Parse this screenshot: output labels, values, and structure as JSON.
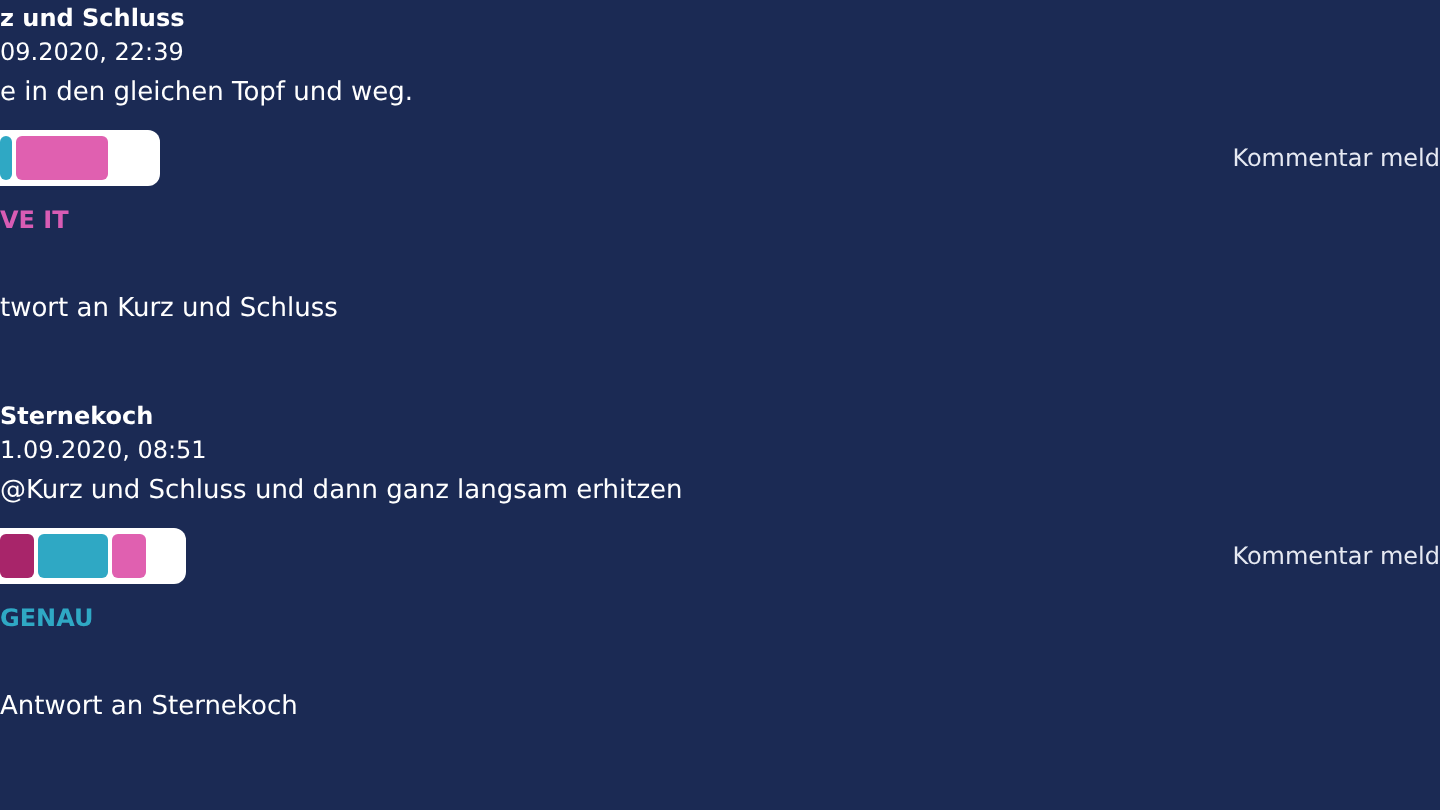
{
  "comments": [
    {
      "author": "z und Schluss",
      "date": "09.2020, 22:39",
      "text": "e in den gleichen Topf und weg.",
      "report": "Kommentar meld",
      "reactions": [
        {
          "color": "#2fa8c4",
          "kind": "sliver"
        },
        {
          "color": "#e060b0",
          "kind": "long"
        }
      ],
      "top_reaction": {
        "label": "VE IT",
        "color": "#d85cb4"
      },
      "reply": "twort an Kurz und Schluss"
    },
    {
      "author": "Sternekoch",
      "date": "1.09.2020, 08:51",
      "text": "@Kurz und Schluss und dann ganz langsam erhitzen",
      "report": "Kommentar meld",
      "reactions": [
        {
          "color": "#a8256a",
          "kind": "short"
        },
        {
          "color": "#2fa8c4",
          "kind": "wide"
        },
        {
          "color": "#e060b0",
          "kind": "short"
        }
      ],
      "top_reaction": {
        "label": "GENAU",
        "color": "#2fa8c4"
      },
      "reply": "Antwort an Sternekoch"
    }
  ]
}
